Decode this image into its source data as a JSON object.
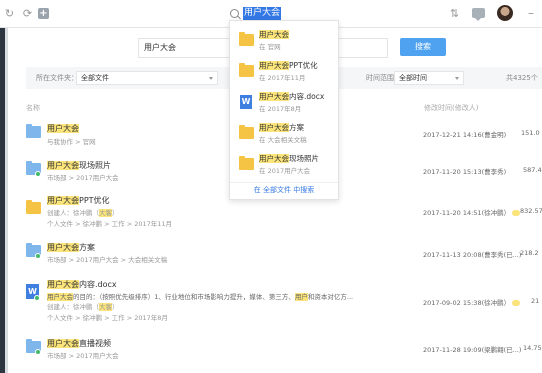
{
  "topbar": {
    "search_value": "用户大会"
  },
  "hero": {
    "search_value": "用户大会",
    "search_button": "搜索"
  },
  "filters": {
    "folder_label": "所在文件夹：",
    "folder_value": "全部文件",
    "time_label": "时间范围",
    "time_value": "全部时间",
    "result_count": "共4325个"
  },
  "columns": {
    "name": "名称",
    "modified": "修改时间(修改人)"
  },
  "rows": [
    {
      "name_hl": "用户大会",
      "name_rest": "",
      "sub": "与我协作 > 官网",
      "time": "2017-12-21 14:16(曹金明)",
      "size": "151.0"
    },
    {
      "name_hl": "用户大会",
      "name_rest": "现场照片",
      "sub": "市场部 > 2017用户大会",
      "time": "2017-11-20 15:13(曹李秀)",
      "size": "587.4"
    },
    {
      "name_hl": "用户大会",
      "name_rest": "PPT优化",
      "sub1": "创建人：徐冲鹏（",
      "sub1_tag": "大客",
      "sub1_end": "）",
      "sub2": "个人文件 > 徐冲鹏 > 工作 > 2017年11月",
      "time": "2017-11-20 14:51(徐冲鹏）",
      "size": "832.57"
    },
    {
      "name_hl": "用户大会",
      "name_rest": "方案",
      "sub": "市场部 > 2017用户大会 > 大会相关文稿",
      "time": "2017-11-13 20:08(曹李秀(已...)",
      "size": "218.2"
    },
    {
      "name_hl": "用户大会",
      "name_rest": "内容.docx",
      "doc_letter": "W",
      "line1_hl": "用户大会",
      "line1_rest": "的目的：（按照优先级排序）1、行业地位和市场影响力提升，媒体、第三方、",
      "line1_hl2": "用户",
      "line1_end": "和资本对亿方...",
      "sub1": "创建人：徐冲鹏（",
      "sub1_tag": "大客",
      "sub1_end": "）",
      "sub2": "个人文件 > 徐冲鹏 > 工作 > 2017年8月",
      "time": "2017-09-02 15:38(徐冲鹏）",
      "size": "21"
    },
    {
      "name_hl": "用户大会",
      "name_rest": "直播视频",
      "sub": "市场部 > 2017用户大会",
      "time": "2017-11-28 19:09(梁鹏翱(已...)",
      "size": "14.75"
    }
  ],
  "dropdown": {
    "items": [
      {
        "title_hl": "用户大会",
        "title_rest": "",
        "sub": "在 官网"
      },
      {
        "title_hl": "用户大会",
        "title_rest": "PPT优化",
        "sub": "在 2017年11月"
      },
      {
        "title_hl": "用户大会",
        "title_rest": "内容.docx",
        "sub": "在 2017年8月",
        "doc_letter": "W"
      },
      {
        "title_hl": "用户大会",
        "title_rest": "方案",
        "sub": "在 大会相关文稿"
      },
      {
        "title_hl": "用户大会",
        "title_rest": "现场照片",
        "sub": "在 2017用户大会"
      }
    ],
    "footer": "在 全部文件 中搜索"
  },
  "icons": {
    "back": "back-arrow-icon",
    "refresh": "refresh-icon",
    "add": "add-icon",
    "sort": "sort-icon",
    "message": "message-icon",
    "search": "search-icon"
  },
  "colors": {
    "accent": "#3478e5",
    "button": "#4fa2f0",
    "highlight": "#fbe47a",
    "folder": "#f6c445",
    "folder_shared": "#7fb6ec",
    "share": "#42b96a"
  }
}
